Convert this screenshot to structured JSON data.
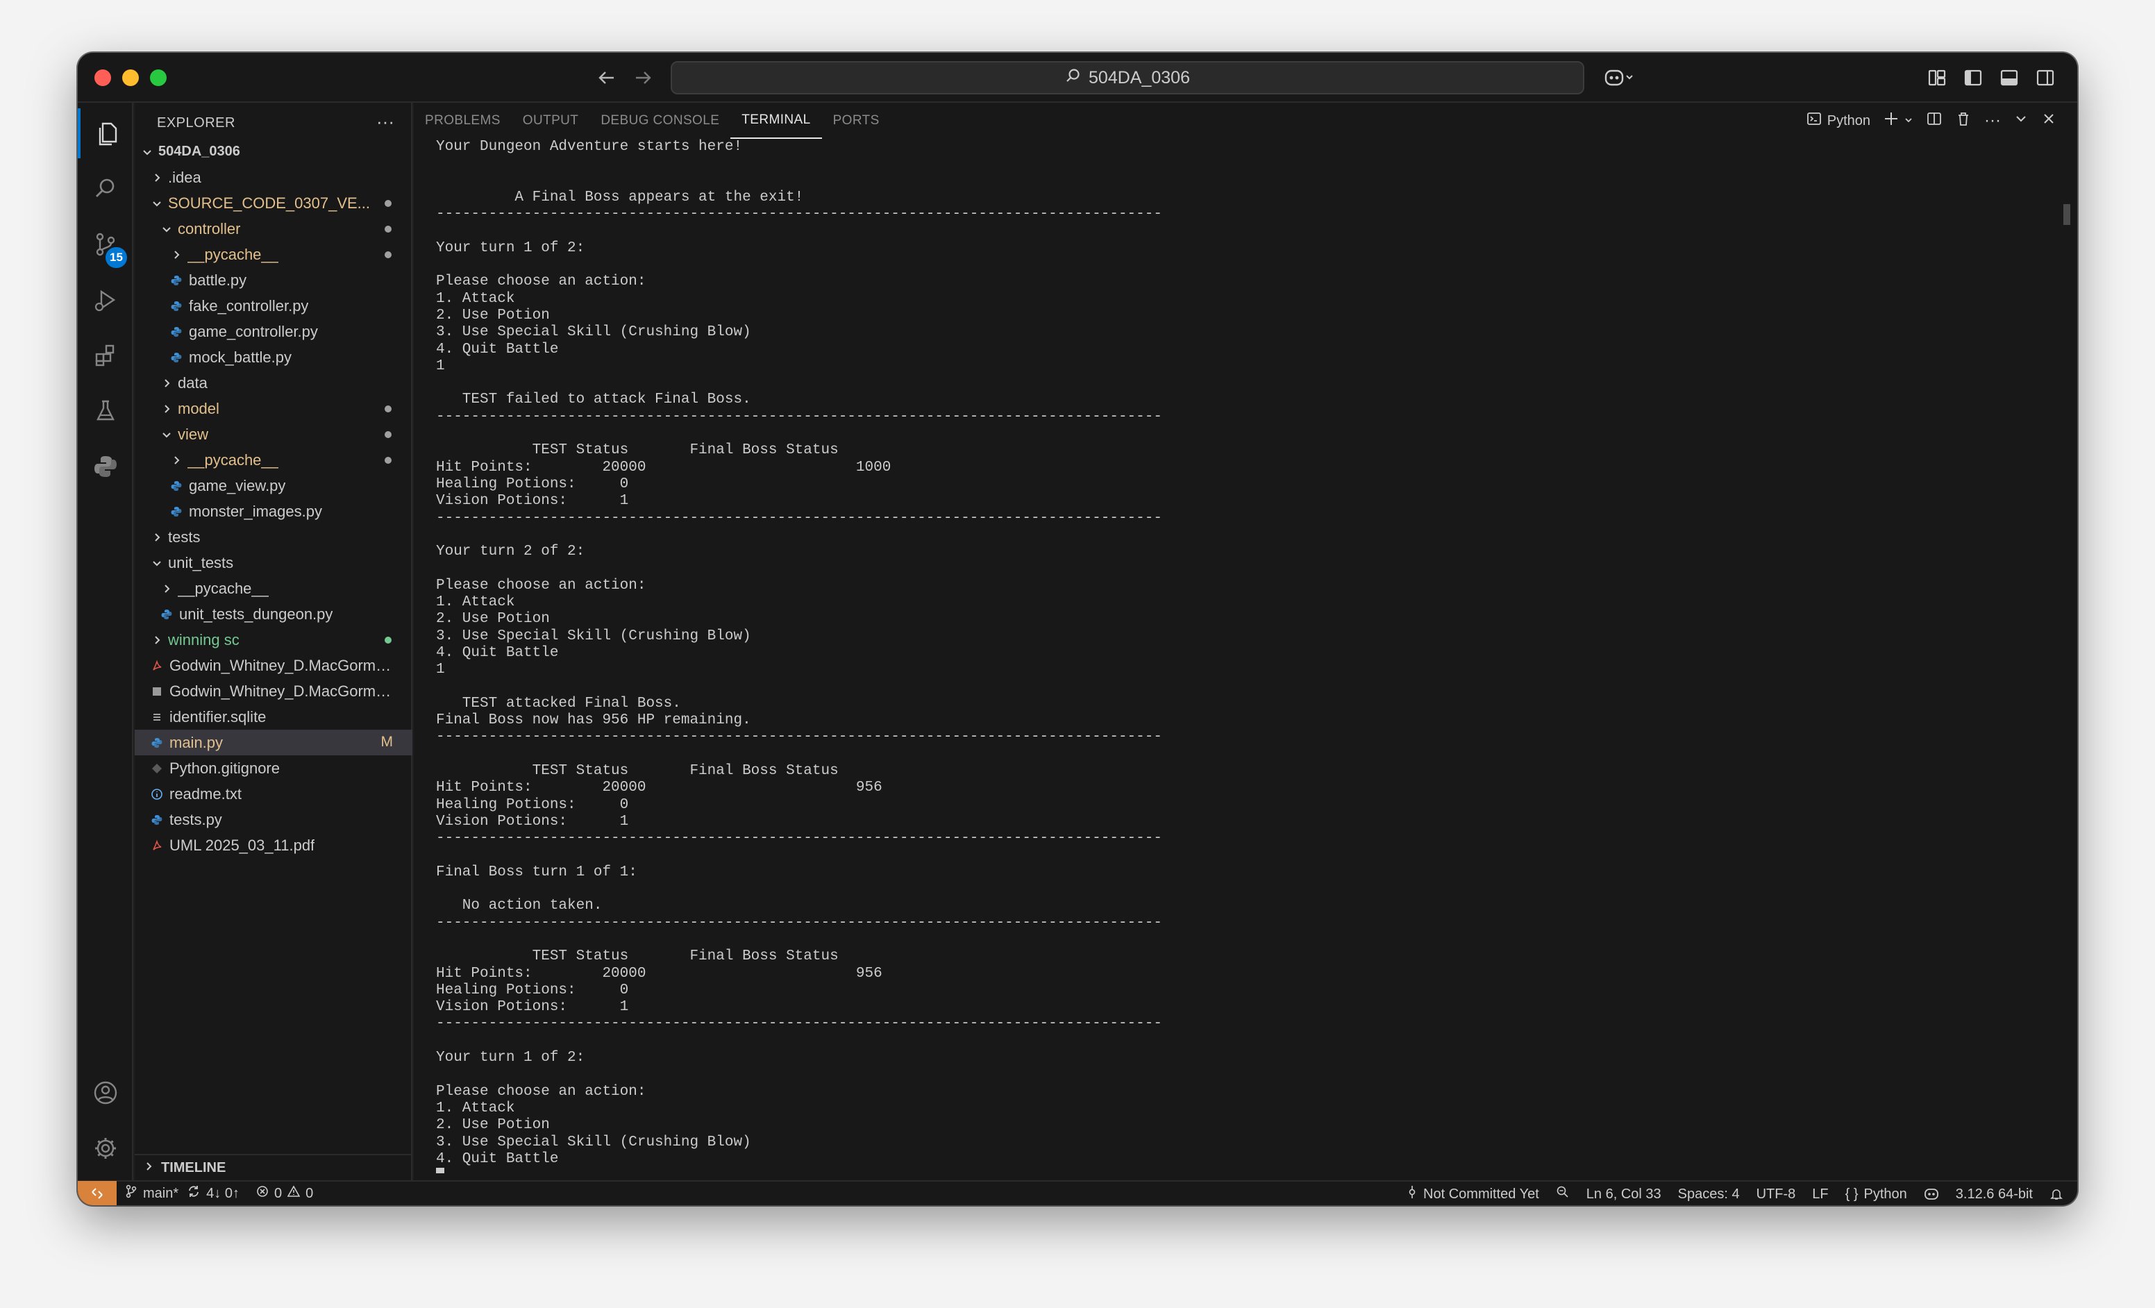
{
  "titlebar": {
    "search_text": "504DA_0306"
  },
  "activity_badge": "15",
  "explorer": {
    "header": "EXPLORER",
    "root": "504DA_0306",
    "items": [
      {
        "label": ".idea",
        "indent": 1,
        "kind": "folder",
        "open": false,
        "color": "#cccccc"
      },
      {
        "label": "SOURCE_CODE_0307_VE...",
        "indent": 1,
        "kind": "folder",
        "open": true,
        "color": "#e2c08d",
        "dot": "#a0a0a0"
      },
      {
        "label": "controller",
        "indent": 2,
        "kind": "folder",
        "open": true,
        "color": "#e2c08d",
        "dot": "#a0a0a0"
      },
      {
        "label": "__pycache__",
        "indent": 3,
        "kind": "folder",
        "open": false,
        "color": "#e2c08d",
        "dot": "#a0a0a0"
      },
      {
        "label": "battle.py",
        "indent": 3,
        "kind": "py",
        "color": "#cccccc"
      },
      {
        "label": "fake_controller.py",
        "indent": 3,
        "kind": "py",
        "color": "#cccccc"
      },
      {
        "label": "game_controller.py",
        "indent": 3,
        "kind": "py",
        "color": "#cccccc"
      },
      {
        "label": "mock_battle.py",
        "indent": 3,
        "kind": "py",
        "color": "#cccccc"
      },
      {
        "label": "data",
        "indent": 2,
        "kind": "folder",
        "open": false,
        "color": "#cccccc"
      },
      {
        "label": "model",
        "indent": 2,
        "kind": "folder",
        "open": false,
        "color": "#e2c08d",
        "dot": "#a0a0a0"
      },
      {
        "label": "view",
        "indent": 2,
        "kind": "folder",
        "open": true,
        "color": "#e2c08d",
        "dot": "#a0a0a0"
      },
      {
        "label": "__pycache__",
        "indent": 3,
        "kind": "folder",
        "open": false,
        "color": "#e2c08d",
        "dot": "#a0a0a0"
      },
      {
        "label": "game_view.py",
        "indent": 3,
        "kind": "py",
        "color": "#cccccc"
      },
      {
        "label": "monster_images.py",
        "indent": 3,
        "kind": "py",
        "color": "#cccccc"
      },
      {
        "label": "tests",
        "indent": 1,
        "kind": "folder",
        "open": false,
        "color": "#cccccc"
      },
      {
        "label": "unit_tests",
        "indent": 1,
        "kind": "folder",
        "open": true,
        "color": "#cccccc"
      },
      {
        "label": "__pycache__",
        "indent": 2,
        "kind": "folder",
        "open": false,
        "color": "#cccccc"
      },
      {
        "label": "unit_tests_dungeon.py",
        "indent": 2,
        "kind": "py",
        "color": "#cccccc"
      },
      {
        "label": "winning sc",
        "indent": 1,
        "kind": "folder",
        "open": false,
        "color": "#73c991",
        "dot": "#73c991"
      },
      {
        "label": "Godwin_Whitney_D.MacGormai...",
        "indent": 1,
        "kind": "pdf",
        "color": "#cccccc"
      },
      {
        "label": "Godwin_Whitney_D.MacGormai...",
        "indent": 1,
        "kind": "img",
        "color": "#cccccc"
      },
      {
        "label": "identifier.sqlite",
        "indent": 1,
        "kind": "txt",
        "color": "#cccccc"
      },
      {
        "label": "main.py",
        "indent": 1,
        "kind": "py",
        "color": "#e2c08d",
        "mark": "M",
        "selected": true
      },
      {
        "label": "Python.gitignore",
        "indent": 1,
        "kind": "git",
        "color": "#cccccc"
      },
      {
        "label": "readme.txt",
        "indent": 1,
        "kind": "info",
        "color": "#cccccc"
      },
      {
        "label": "tests.py",
        "indent": 1,
        "kind": "py",
        "color": "#cccccc"
      },
      {
        "label": "UML 2025_03_11.pdf",
        "indent": 1,
        "kind": "pdf",
        "color": "#cccccc"
      }
    ],
    "timeline": "TIMELINE"
  },
  "panel": {
    "tabs": [
      "PROBLEMS",
      "OUTPUT",
      "DEBUG CONSOLE",
      "TERMINAL",
      "PORTS"
    ],
    "active_tab": "TERMINAL",
    "shell_label": "Python"
  },
  "terminal": {
    "lines": [
      "Your Dungeon Adventure starts here!",
      "",
      "",
      "         A Final Boss appears at the exit!",
      "-----------------------------------------------------------------------------------",
      "",
      "Your turn 1 of 2:",
      "",
      "Please choose an action:",
      "1. Attack",
      "2. Use Potion",
      "3. Use Special Skill (Crushing Blow)",
      "4. Quit Battle",
      "1",
      "",
      "   TEST failed to attack Final Boss.",
      "-----------------------------------------------------------------------------------",
      "",
      "           TEST Status       Final Boss Status",
      "Hit Points:        20000                        1000",
      "Healing Potions:     0",
      "Vision Potions:      1",
      "-----------------------------------------------------------------------------------",
      "",
      "Your turn 2 of 2:",
      "",
      "Please choose an action:",
      "1. Attack",
      "2. Use Potion",
      "3. Use Special Skill (Crushing Blow)",
      "4. Quit Battle",
      "1",
      "",
      "   TEST attacked Final Boss.",
      "Final Boss now has 956 HP remaining.",
      "-----------------------------------------------------------------------------------",
      "",
      "           TEST Status       Final Boss Status",
      "Hit Points:        20000                        956",
      "Healing Potions:     0",
      "Vision Potions:      1",
      "-----------------------------------------------------------------------------------",
      "",
      "Final Boss turn 1 of 1:",
      "",
      "   No action taken.",
      "-----------------------------------------------------------------------------------",
      "",
      "           TEST Status       Final Boss Status",
      "Hit Points:        20000                        956",
      "Healing Potions:     0",
      "Vision Potions:      1",
      "-----------------------------------------------------------------------------------",
      "",
      "Your turn 1 of 2:",
      "",
      "Please choose an action:",
      "1. Attack",
      "2. Use Potion",
      "3. Use Special Skill (Crushing Blow)",
      "4. Quit Battle"
    ]
  },
  "statusbar": {
    "branch": "main*",
    "sync": "4↓ 0↑",
    "errors": "0",
    "warnings": "0",
    "blame": "Not Committed Yet",
    "position": "Ln 6, Col 33",
    "spaces": "Spaces: 4",
    "encoding": "UTF-8",
    "eol": "LF",
    "language": "Python",
    "interpreter": "3.12.6 64-bit"
  }
}
